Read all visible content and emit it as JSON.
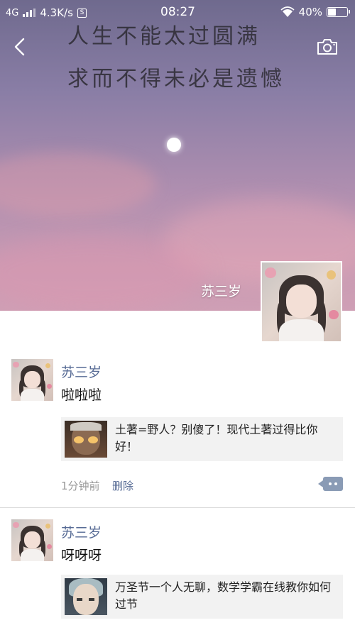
{
  "status_bar": {
    "network": "4G",
    "speed": "4.3K/s",
    "sim_badge": "S",
    "time": "08:27",
    "battery": "40%",
    "battery_level": 0.4
  },
  "cover": {
    "quote_line1": "人生不能太过圆满",
    "quote_line2": "求而不得未必是遗憾",
    "name": "苏三岁"
  },
  "posts": [
    {
      "name": "苏三岁",
      "text": "啦啦啦",
      "share_text": "土著=野人？别傻了！现代土著过得比你好！",
      "time": "1分钟前",
      "delete_label": "删除"
    },
    {
      "name": "苏三岁",
      "text": "呀呀呀",
      "share_text": "万圣节一个人无聊，数学学霸在线教你如何过节"
    }
  ],
  "icons": {
    "back": "back-icon",
    "camera": "camera-icon",
    "more": "more-icon"
  },
  "colors": {
    "link": "#576b95",
    "card_bg": "#f2f2f2"
  }
}
